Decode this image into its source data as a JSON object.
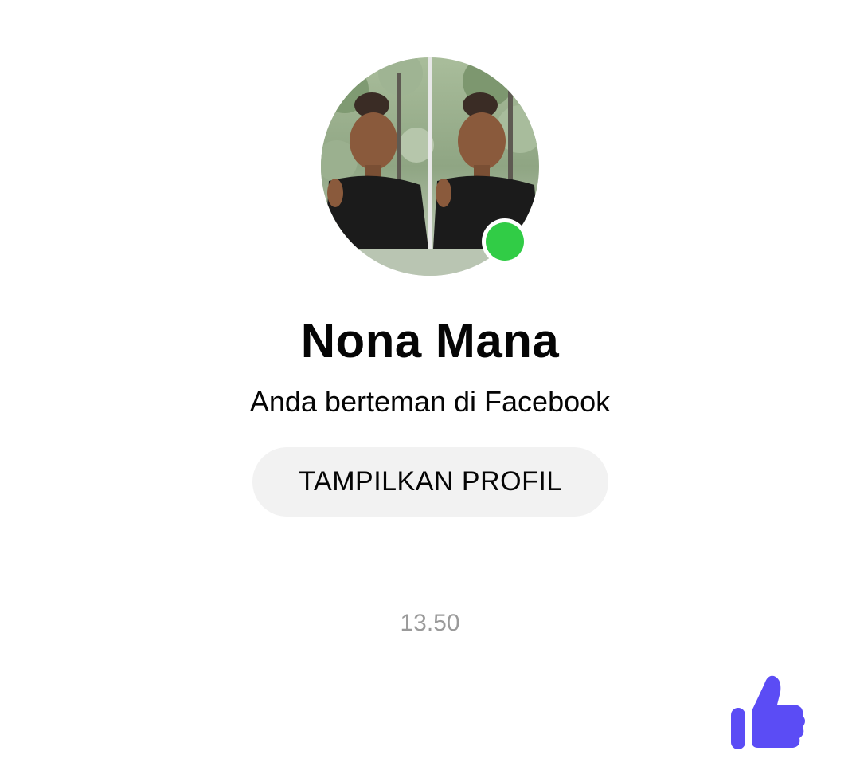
{
  "contact": {
    "name": "Nona Mana",
    "relationship": "Anda berteman di Facebook",
    "online_status_color": "#31cc46",
    "avatar_icon": "profile-photo"
  },
  "actions": {
    "view_profile_label": "TAMPILKAN PROFIL"
  },
  "chat": {
    "timestamp": "13.50"
  },
  "composer": {
    "like_icon": "thumbs-up-icon",
    "accent_color": "#5b4cf5"
  }
}
